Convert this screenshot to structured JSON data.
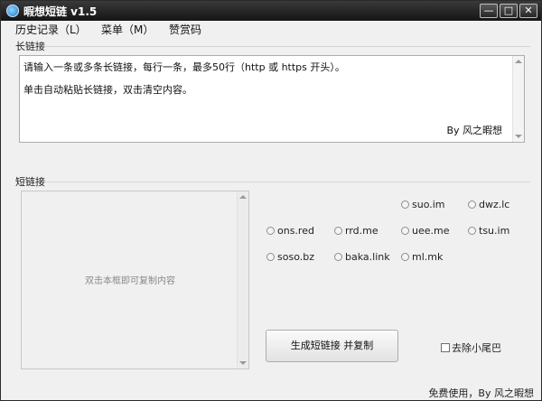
{
  "window": {
    "title": "暇想短链 v1.5"
  },
  "window_controls": {
    "minimize": "—",
    "maximize": "□",
    "close": "✕"
  },
  "menu": {
    "items": [
      "历史记录（L）",
      "菜单（M）",
      "赞赏码"
    ]
  },
  "long_link": {
    "group_label": "长链接",
    "text_lines": [
      "请输入一条或多条长链接，每行一条，最多50行（http 或 https 开头）。",
      "单击自动粘贴长链接，双击清空内容。"
    ],
    "author": "By 风之暇想"
  },
  "short_link": {
    "group_label": "短链接",
    "hint": "双击本框即可复制内容"
  },
  "services": [
    "suo.im",
    "dwz.lc",
    "ons.red",
    "rrd.me",
    "uee.me",
    "tsu.im",
    "soso.bz",
    "baka.link",
    "ml.mk"
  ],
  "generate_button": "生成短链接 并复制",
  "remove_tail_checkbox": {
    "label": "去除小尾巴",
    "checked": false
  },
  "status_text": "免费使用，By 风之暇想"
}
